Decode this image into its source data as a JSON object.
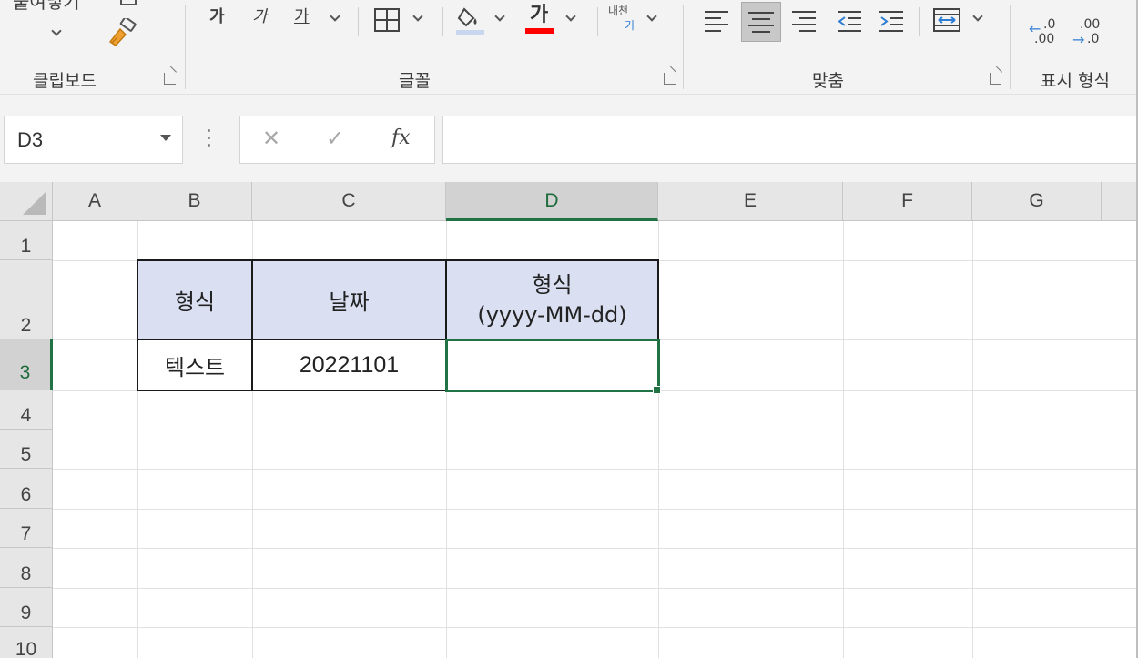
{
  "ribbon": {
    "clipboard": {
      "paste_label": "붙여넣기",
      "group_label": "클립보드"
    },
    "font": {
      "bold_glyph": "가",
      "italic_glyph": "가",
      "underline_glyph": "가",
      "font_color_glyph": "가",
      "phonetic_top": "내천",
      "phonetic_bottom": "기",
      "group_label": "글꼴",
      "font_color": "#ff0000"
    },
    "alignment": {
      "group_label": "맞춤"
    },
    "number": {
      "group_label": "표시 형식",
      "increase_decimal_top": ".0",
      "increase_decimal_bottom": ".00",
      "decrease_decimal_top": ".00",
      "decrease_decimal_bottom": ".0"
    }
  },
  "formula_bar": {
    "name_box": "D3",
    "cancel_symbol": "✕",
    "enter_symbol": "✓",
    "fx_label": "fx",
    "formula": ""
  },
  "grid": {
    "columns": [
      "A",
      "B",
      "C",
      "D",
      "E",
      "F",
      "G"
    ],
    "selected_column": "D",
    "rows": [
      "1",
      "2",
      "3",
      "4",
      "5",
      "6",
      "7",
      "8",
      "9",
      "10"
    ],
    "selected_row": "3",
    "active_cell": "D3",
    "cells": {
      "B2": "형식",
      "C2": "날짜",
      "D2_line1": "형식",
      "D2_line2": "(yyyy-MM-dd)",
      "B3": "텍스트",
      "C3": "20221101",
      "D3": ""
    },
    "header_fill": "#dae0f2",
    "accent": "#217346"
  }
}
